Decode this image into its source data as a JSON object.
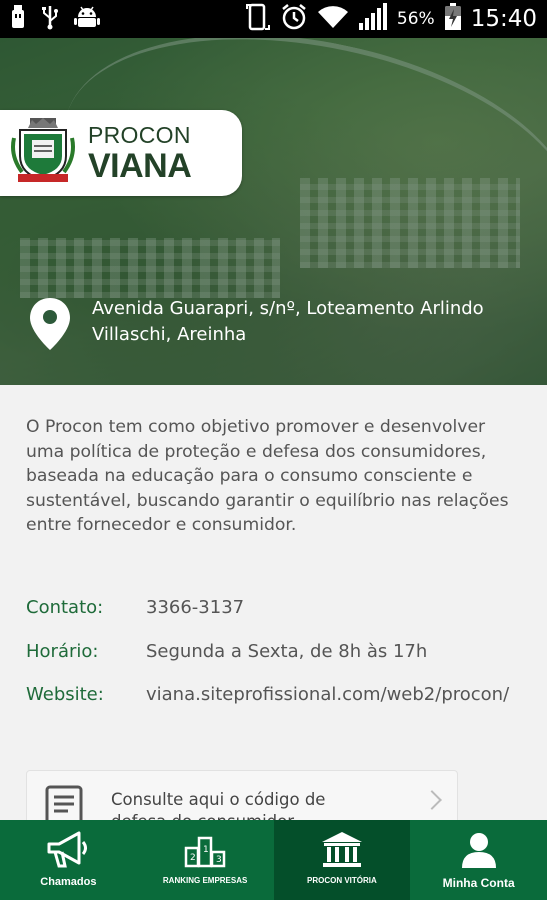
{
  "status_bar": {
    "battery_percent": "56%",
    "time": "15:40",
    "icons": [
      "usb-icon",
      "usb-debug-icon",
      "android-icon",
      "screen-rotation-icon",
      "alarm-icon",
      "wifi-icon",
      "cell-signal-icon",
      "battery-charging-icon"
    ]
  },
  "header": {
    "logo_line1": "PROCON",
    "logo_line2": "VIANA",
    "address": "Avenida Guarapri, s/nº, Loteamento Arlindo Villaschi, Areinha"
  },
  "main": {
    "description": "O Procon tem como objetivo promover e desenvolver uma política de proteção e defesa dos consumidores, baseada na educação para o consumo consciente e sustentável, buscando garantir o equilíbrio nas relações entre fornecedor e consumidor.",
    "contato_label": "Contato:",
    "contato_value": "3366-3137",
    "horario_label": "Horário:",
    "horario_value": "Segunda a Sexta, de 8h às 17h",
    "website_label": "Website:",
    "website_value": "viana.siteprofissional.com/web2/procon/",
    "code_card_text": "Consulte aqui o código de defesa do consumidor"
  },
  "bottom_nav": {
    "items": [
      {
        "label": "Chamados",
        "icon": "megaphone-icon"
      },
      {
        "label": "Ranking Empresas",
        "icon": "podium-icon"
      },
      {
        "label": "Procon Vitória",
        "icon": "courthouse-icon"
      },
      {
        "label": "Minha Conta",
        "icon": "user-icon"
      }
    ],
    "active_index": 2
  },
  "colors": {
    "brand_green": "#0a6b3b",
    "brand_green_dark": "#044f2a",
    "label_green": "#1f6b3a",
    "background": "#f2f2f2"
  }
}
